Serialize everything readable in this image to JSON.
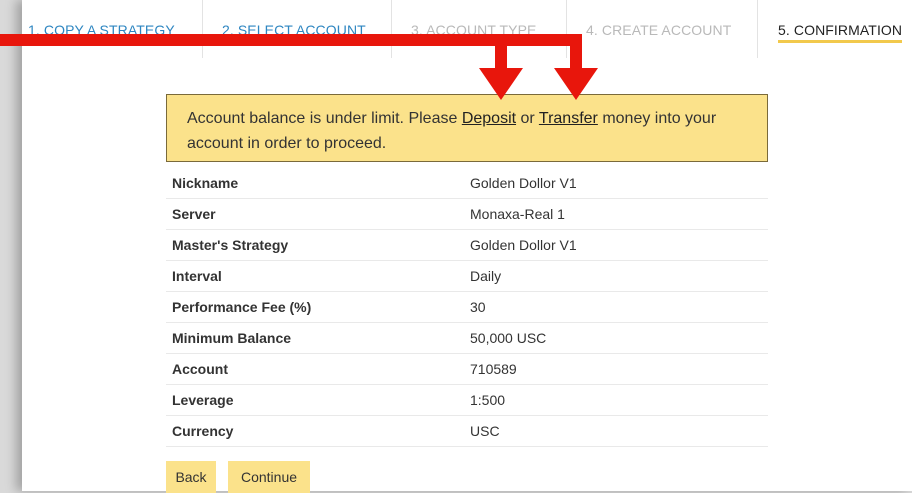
{
  "tabs": [
    {
      "label": "1. COPY A STRATEGY",
      "state": "link"
    },
    {
      "label": "2. SELECT ACCOUNT",
      "state": "link"
    },
    {
      "label": "3. ACCOUNT TYPE",
      "state": "disabled"
    },
    {
      "label": "4. CREATE ACCOUNT",
      "state": "disabled"
    },
    {
      "label": "5. CONFIRMATION",
      "state": "active"
    }
  ],
  "alert": {
    "text_before": "Account balance is under limit. Please ",
    "deposit_link": "Deposit",
    "text_middle": " or ",
    "transfer_link": "Transfer",
    "text_after": " money into your account in order to proceed."
  },
  "details": [
    {
      "label": "Nickname",
      "value": "Golden Dollor V1"
    },
    {
      "label": "Server",
      "value": "Monaxa-Real 1"
    },
    {
      "label": "Master's Strategy",
      "value": "Golden Dollor V1"
    },
    {
      "label": "Interval",
      "value": "Daily"
    },
    {
      "label": "Performance Fee (%)",
      "value": "30"
    },
    {
      "label": "Minimum Balance",
      "value": "50,000 USC"
    },
    {
      "label": "Account",
      "value": "710589"
    },
    {
      "label": "Leverage",
      "value": "1:500"
    },
    {
      "label": "Currency",
      "value": "USC"
    }
  ],
  "buttons": {
    "back": "Back",
    "continue": "Continue"
  },
  "colors": {
    "accent": "#fbe28b",
    "link": "#2e86c1",
    "arrow": "#e8160c"
  }
}
